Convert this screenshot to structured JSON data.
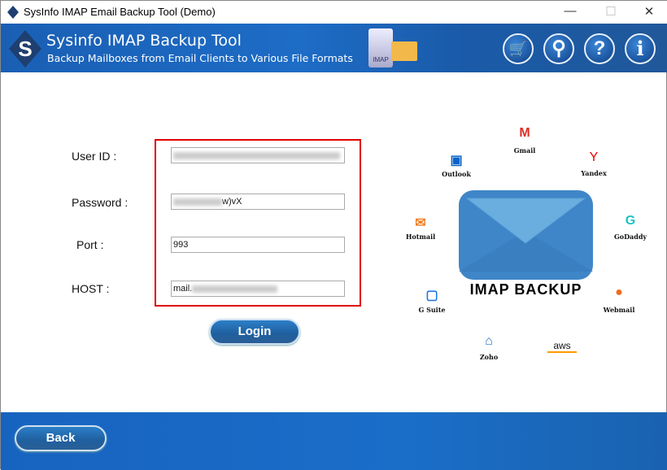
{
  "window": {
    "title": "SysInfo IMAP Email Backup Tool (Demo)",
    "minimize": "—",
    "maximize": "☐",
    "close": "✕"
  },
  "header": {
    "title": "Sysinfo IMAP Backup Tool",
    "subtitle": "Backup Mailboxes from Email Clients to Various File Formats",
    "logo_letter": "S",
    "imap_badge": "IMAP",
    "buttons": [
      {
        "name": "buy",
        "glyph": "🛒"
      },
      {
        "name": "activate",
        "glyph": "⚲"
      },
      {
        "name": "help",
        "glyph": "?"
      },
      {
        "name": "info",
        "glyph": "i"
      }
    ]
  },
  "form": {
    "user_id_label": "User ID  :",
    "user_id_value": "",
    "password_label": "Password  :",
    "password_value_visible": "w)vX",
    "port_label": "Port  :",
    "port_value": "993",
    "host_label": "HOST  :",
    "host_value_visible": "mail.",
    "login_label": "Login",
    "highlight_color": "#e00000"
  },
  "graphic": {
    "caption": "IMAP BACKUP",
    "services": [
      "Gmail",
      "Outlook",
      "Yandex",
      "Hotmail",
      "GoDaddy",
      "G Suite",
      "Webmail",
      "Zoho",
      "aws"
    ]
  },
  "footer": {
    "back_label": "Back"
  }
}
